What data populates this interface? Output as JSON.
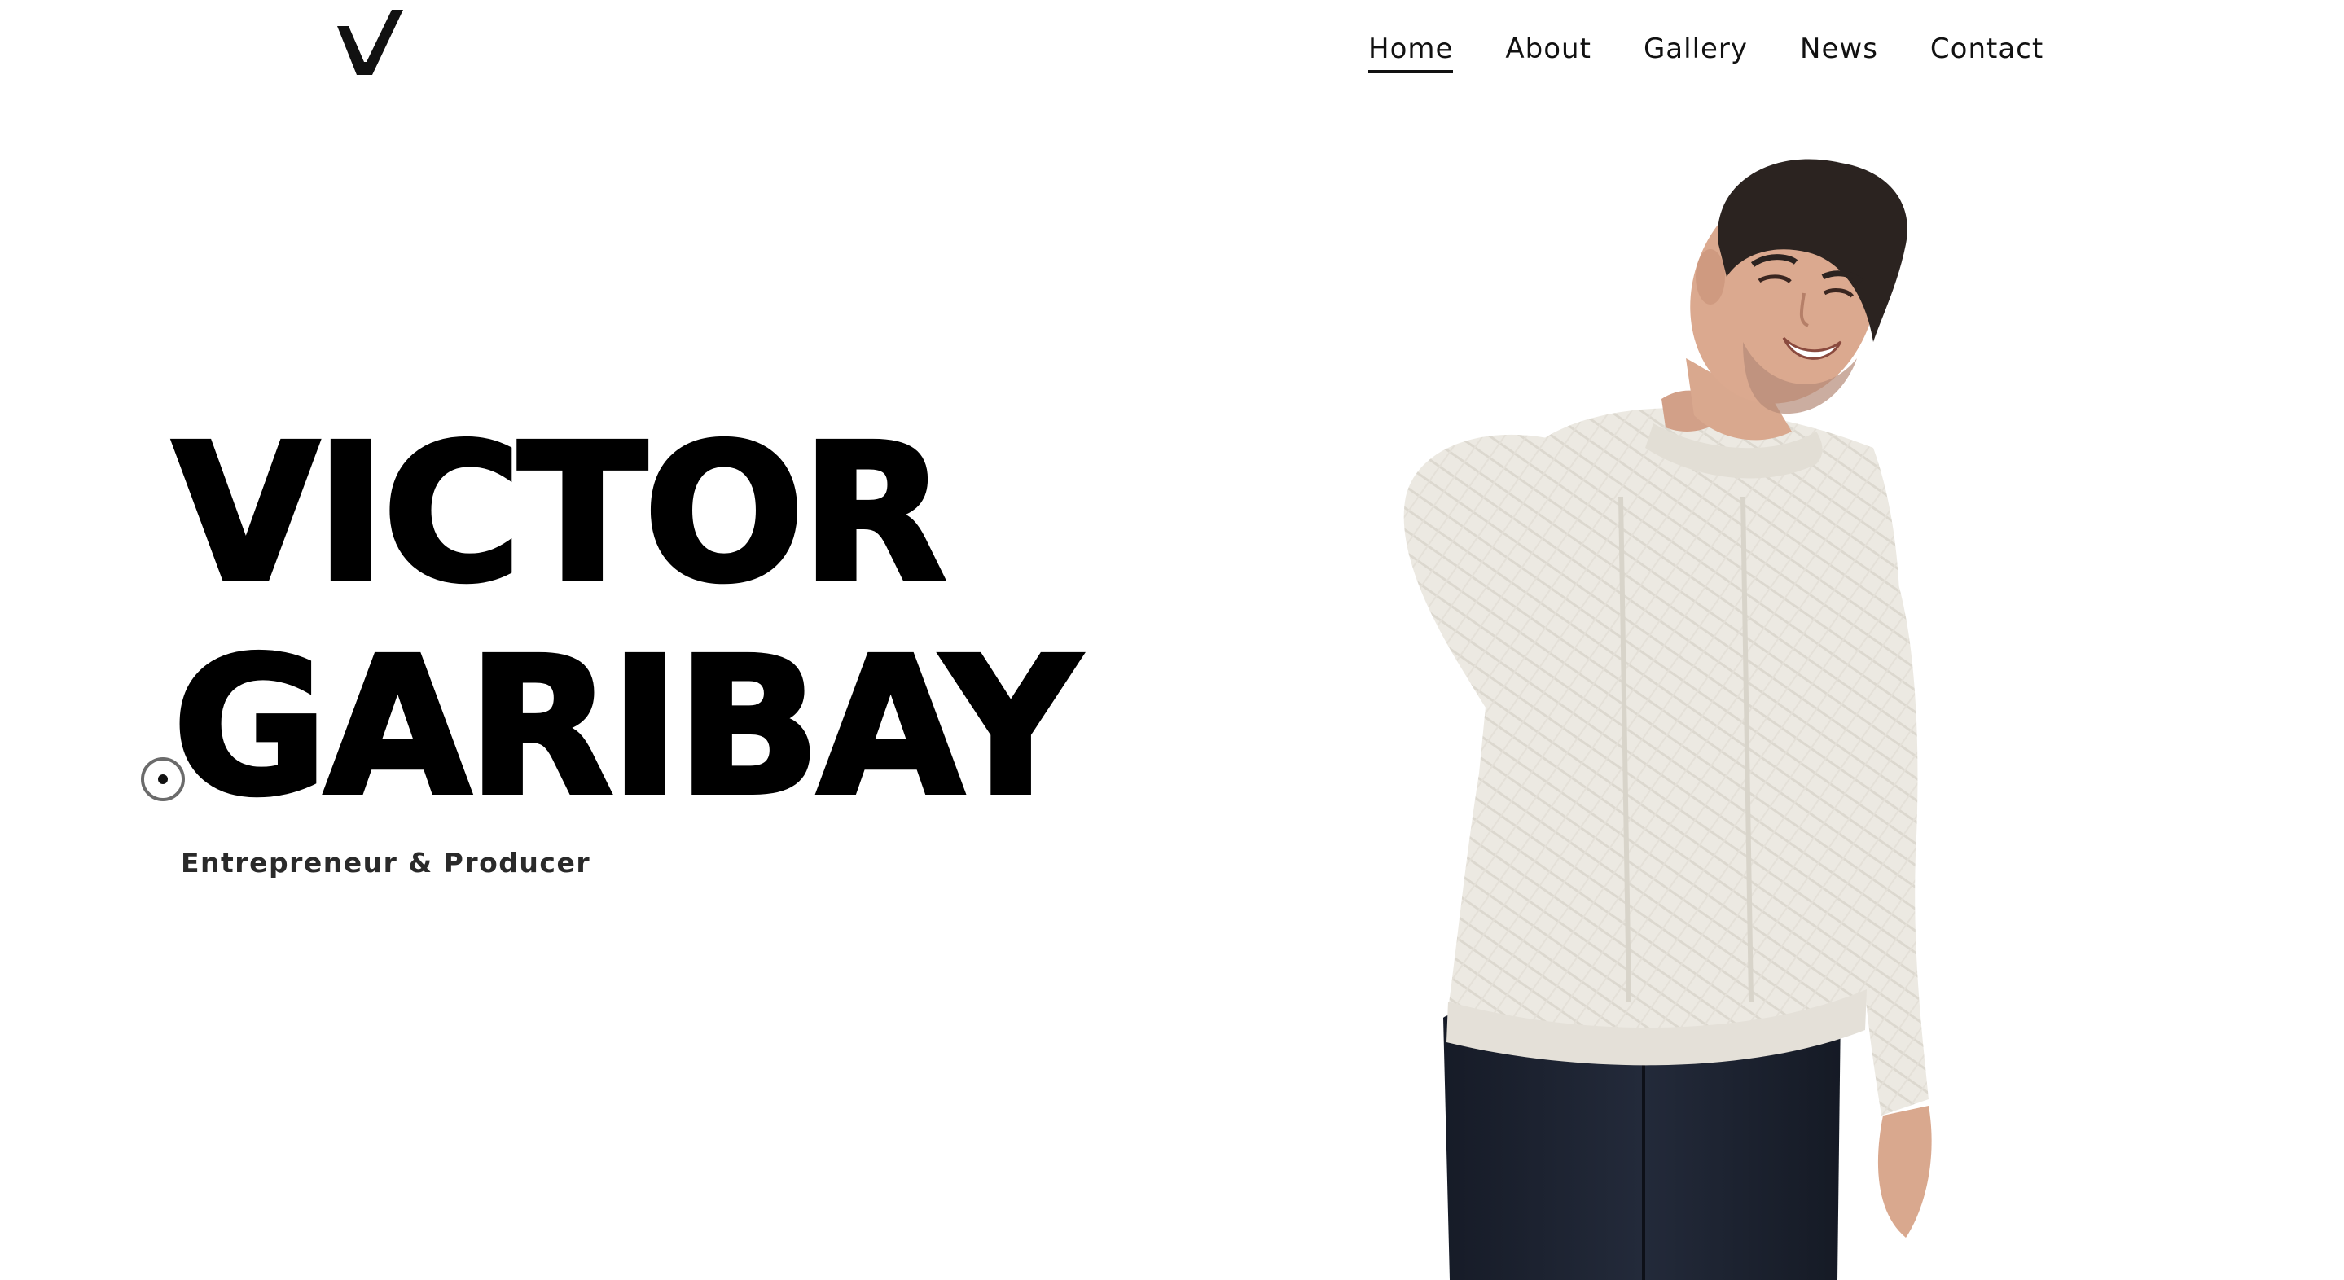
{
  "header": {
    "logo_text": "V",
    "nav": [
      {
        "label": "Home",
        "active": true
      },
      {
        "label": "About",
        "active": false
      },
      {
        "label": "Gallery",
        "active": false
      },
      {
        "label": "News",
        "active": false
      },
      {
        "label": "Contact",
        "active": false
      }
    ]
  },
  "hero": {
    "first_name": "VICTOR",
    "last_name": "GARIBAY",
    "tagline": "Entrepreneur & Producer"
  },
  "portrait": {
    "icon": "person-portrait",
    "sweater_color": "#ece9e2",
    "pants_color": "#1c2230",
    "hair_color": "#2b2320",
    "skin_color": "#d9a88e"
  },
  "colors": {
    "background": "#ffffff",
    "text": "#000000",
    "tagline": "#2a2a2a"
  }
}
